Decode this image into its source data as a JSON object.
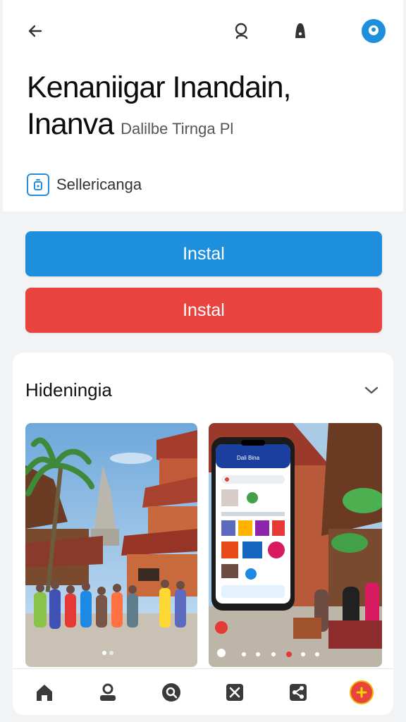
{
  "header": {
    "title_line1": "Kenaniigar Inandain,",
    "title_line2": "Inanva",
    "subtitle": "Dalilbe Tirnga Pl",
    "seller": "Sellericanga"
  },
  "buttons": {
    "primary_label": "Instal",
    "secondary_label": "Instal"
  },
  "gallery": {
    "title": "Hideningia"
  },
  "phone_screen": {
    "header_text": "Dali Bina"
  },
  "icons": {
    "top": [
      "back-arrow-icon",
      "search-icon",
      "bell-icon",
      "profile-icon"
    ],
    "bottom": [
      "home-icon",
      "account-icon",
      "search-icon",
      "close-icon",
      "share-icon",
      "add-icon"
    ]
  },
  "colors": {
    "primary": "#1e8fdd",
    "secondary": "#e8433e",
    "profile_ring": "#1e8fdd",
    "add_fab": "#e8433e"
  }
}
